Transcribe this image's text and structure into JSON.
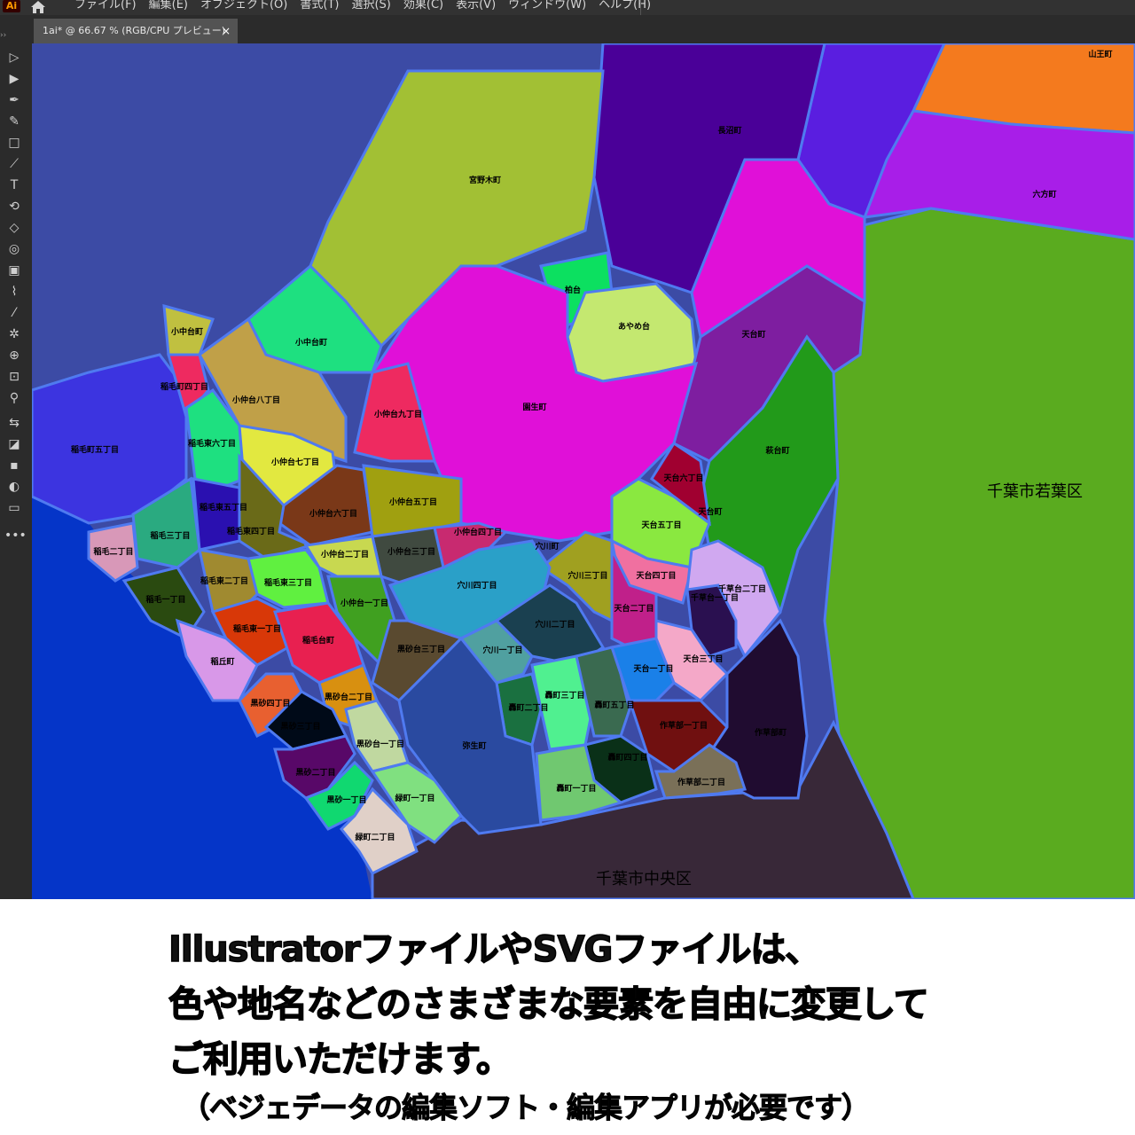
{
  "app": {
    "logo": "Ai",
    "home_icon": "home-icon",
    "menus": [
      "ファイル(F)",
      "編集(E)",
      "オブジェクト(O)",
      "書式(T)",
      "選択(S)",
      "効果(C)",
      "表示(V)",
      "ウィンドウ(W)",
      "ヘルプ(H)"
    ],
    "tab_title": "1ai* @ 66.67 % (RGB/CPU プレビュー)",
    "tab_close": "×",
    "panel_arrows": "››"
  },
  "tools": [
    {
      "name": "selection-tool-icon",
      "glyph": "▷"
    },
    {
      "name": "direct-selection-tool-icon",
      "glyph": "▶"
    },
    {
      "name": "pen-tool-icon",
      "glyph": "✒"
    },
    {
      "name": "curvature-tool-icon",
      "glyph": "✎"
    },
    {
      "name": "rectangle-tool-icon",
      "glyph": "□"
    },
    {
      "name": "paintbrush-tool-icon",
      "glyph": "⟋"
    },
    {
      "name": "type-tool-icon",
      "glyph": "T"
    },
    {
      "name": "rotate-tool-icon",
      "glyph": "⟲"
    },
    {
      "name": "eraser-tool-icon",
      "glyph": "◇"
    },
    {
      "name": "warp-tool-icon",
      "glyph": "◎"
    },
    {
      "name": "gradient-tool-icon",
      "glyph": "▣"
    },
    {
      "name": "eyedropper-tool-icon",
      "glyph": "⌇"
    },
    {
      "name": "eyedropper-selected-tool-icon",
      "glyph": "⁄"
    },
    {
      "name": "symbol-sprayer-tool-icon",
      "glyph": "✲"
    },
    {
      "name": "shape-builder-tool-icon",
      "glyph": "⊕"
    },
    {
      "name": "artboard-tool-icon",
      "glyph": "⊡"
    },
    {
      "name": "zoom-tool-icon",
      "glyph": "⚲"
    },
    {
      "name": "swap-colors-icon",
      "glyph": "⇆"
    },
    {
      "name": "fill-stroke-icon",
      "glyph": "◪"
    },
    {
      "name": "color-mode-icon",
      "glyph": "▪"
    },
    {
      "name": "draw-mode-icon",
      "glyph": "◐"
    },
    {
      "name": "screen-mode-icon",
      "glyph": "▭"
    },
    {
      "name": "more-tools-icon",
      "glyph": "•••"
    }
  ],
  "map": {
    "large_labels": {
      "wakaba": "千葉市若葉区",
      "chuo": "千葉市中央区"
    },
    "corner_label": "山王町",
    "place_names": [
      "長沼町",
      "六方町",
      "宮野木町",
      "柏台",
      "あやめ台",
      "天台町",
      "園生町",
      "萩台町",
      "小中台町",
      "小中台町",
      "稲毛町四丁目",
      "小仲台八丁目",
      "小仲台九丁目",
      "稲毛東六丁目",
      "稲毛町五丁目",
      "小仲台七丁目",
      "天台六丁目",
      "天台町",
      "稲毛東五丁目",
      "小仲台六丁目",
      "小仲台五丁目",
      "天台五丁目",
      "稲毛三丁目",
      "稲毛東四丁目",
      "小仲台四丁目",
      "穴川町",
      "稲毛二丁目",
      "小仲台三丁目",
      "小仲台二丁目",
      "穴川三丁目",
      "天台四丁目",
      "千草台二丁目",
      "稲毛東三丁目",
      "稲毛東二丁目",
      "穴川四丁目",
      "稲毛一丁目",
      "小仲台一丁目",
      "天台二丁目",
      "千草台一丁目",
      "穴川二丁目",
      "稲毛東一丁目",
      "稲毛台町",
      "黒砂台三丁目",
      "穴川一丁目",
      "天台三丁目",
      "稲丘町",
      "天台一丁目",
      "轟町三丁目",
      "黒砂台二丁目",
      "黒砂四丁目",
      "轟町二丁目",
      "轟町五丁目",
      "作草部一丁目",
      "作草部町",
      "黒砂三丁目",
      "黒砂台一丁目",
      "弥生町",
      "轟町四丁目",
      "黒砂二丁目",
      "作草部二丁目",
      "轟町一丁目",
      "緑町一丁目",
      "黒砂一丁目",
      "緑町二丁目"
    ]
  },
  "caption": {
    "line1": "IllustratorファイルやSVGファイルは、",
    "line2": "色や地名などのさまざまな要素を自由に変更して",
    "line3": "ご利用いただけます。",
    "note": "（ベジェデータの編集ソフト・編集アプリが必要です）"
  }
}
